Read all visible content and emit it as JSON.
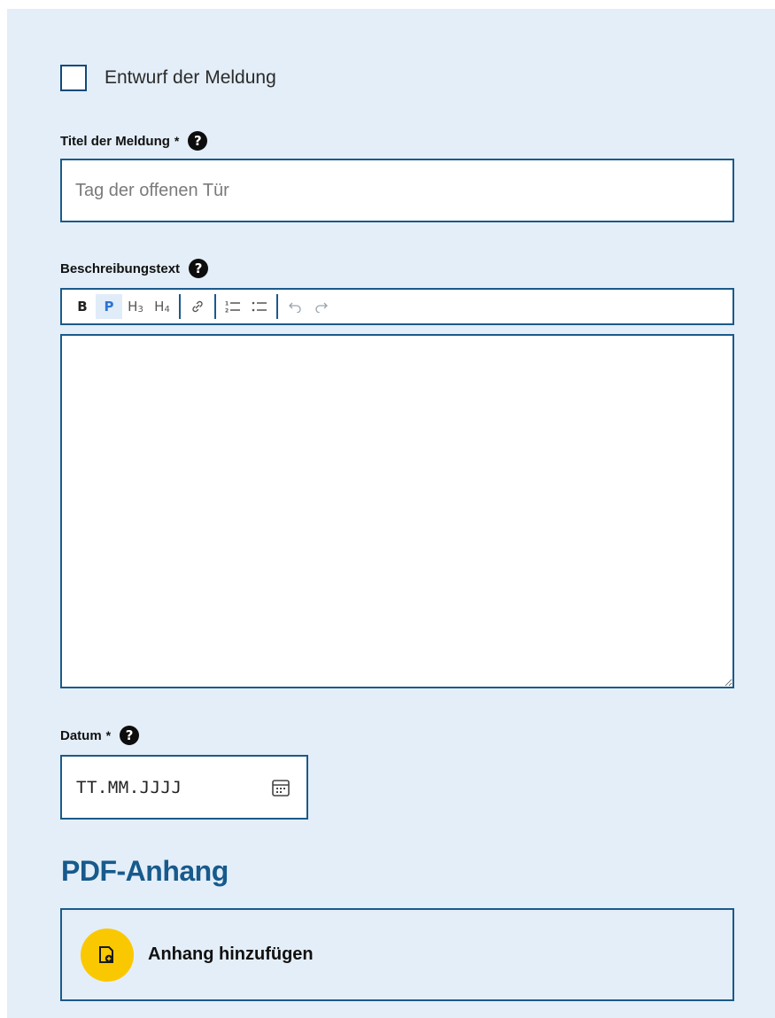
{
  "draft": {
    "label": "Entwurf der Meldung",
    "checked": false
  },
  "title_field": {
    "label": "Titel der Meldung",
    "required_mark": "*",
    "placeholder": "Tag der offenen Tür",
    "value": ""
  },
  "description": {
    "label": "Beschreibungstext",
    "toolbar": {
      "bold": "B",
      "paragraph": "P",
      "h3": "H",
      "h3_sub": "3",
      "h4": "H",
      "h4_sub": "4",
      "active": "paragraph"
    },
    "value": ""
  },
  "date_field": {
    "label": "Datum",
    "required_mark": "*",
    "placeholder": "TT.MM.JJJJ"
  },
  "pdf_section": {
    "title": "PDF-Anhang",
    "add_label": "Anhang hinzufügen"
  },
  "help_glyph": "?",
  "colors": {
    "panel_bg": "#e4eef8",
    "border": "#1b5a8a",
    "heading": "#175a8c",
    "accent_yellow": "#fac800"
  }
}
